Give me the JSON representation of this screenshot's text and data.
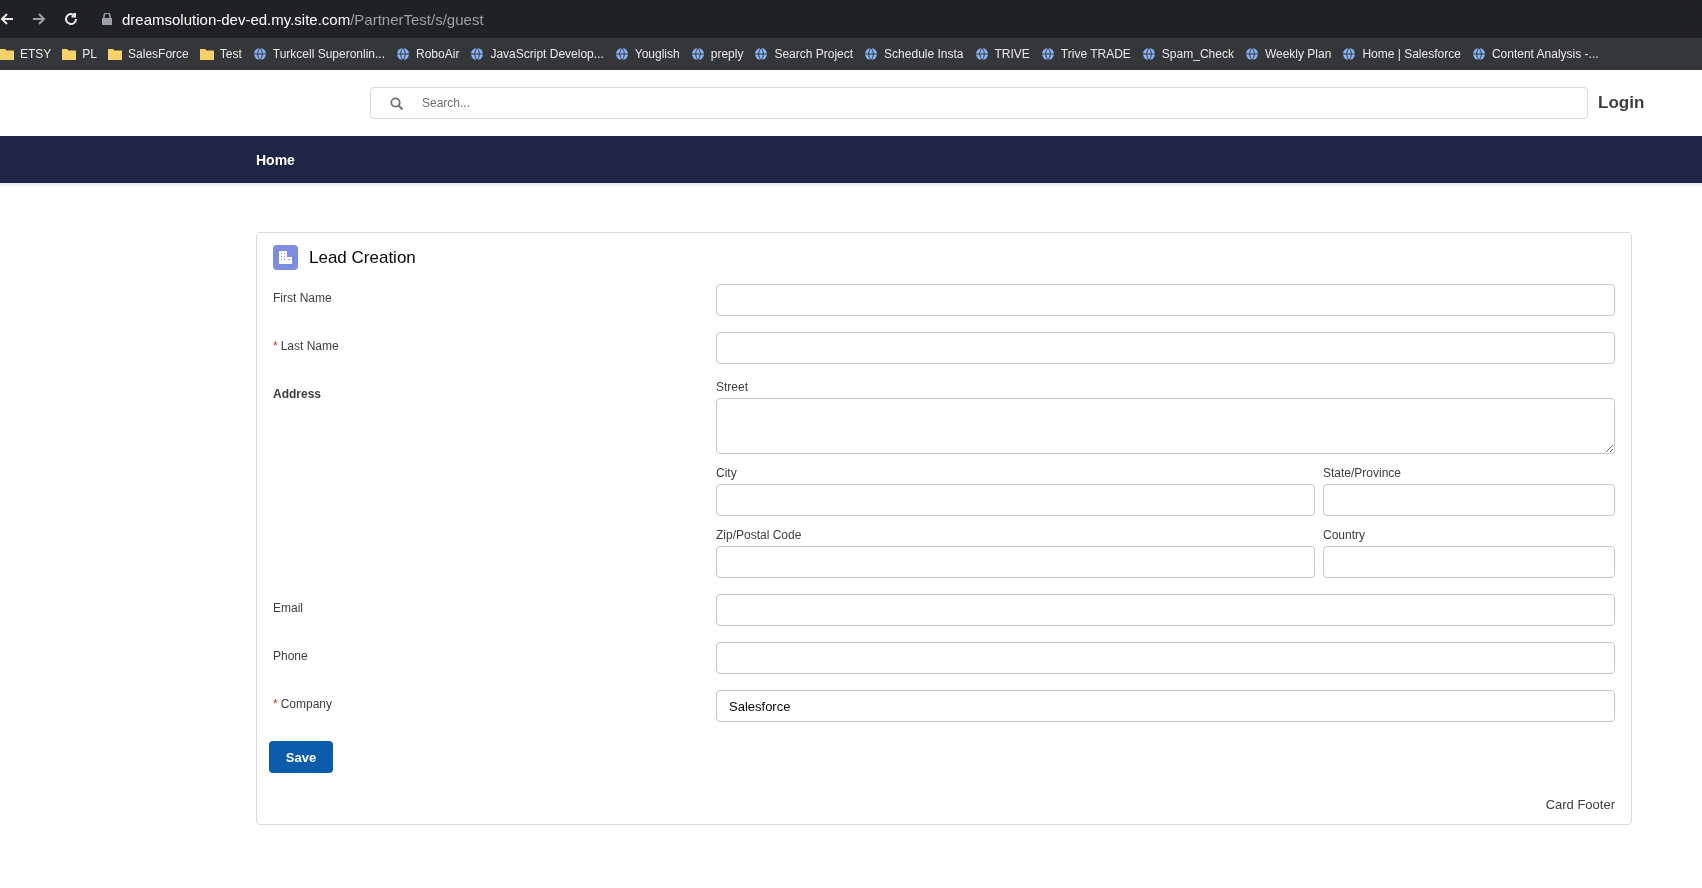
{
  "browser": {
    "url_host": "dreamsolution-dev-ed.my.site.com",
    "url_path": "/PartnerTest/s/guest",
    "bookmarks": [
      {
        "label": "ETSY",
        "kind": "folder"
      },
      {
        "label": "PL",
        "kind": "folder"
      },
      {
        "label": "SalesForce",
        "kind": "folder"
      },
      {
        "label": "Test",
        "kind": "folder"
      },
      {
        "label": "Turkcell Superonlin...",
        "kind": "site"
      },
      {
        "label": "RoboAir",
        "kind": "site"
      },
      {
        "label": "JavaScript Develop...",
        "kind": "site"
      },
      {
        "label": "Youglish",
        "kind": "site"
      },
      {
        "label": "preply",
        "kind": "site"
      },
      {
        "label": "Search Project",
        "kind": "site"
      },
      {
        "label": "Schedule Insta",
        "kind": "site"
      },
      {
        "label": "TRIVE",
        "kind": "site"
      },
      {
        "label": "Trive TRADE",
        "kind": "site"
      },
      {
        "label": "Spam_Check",
        "kind": "site"
      },
      {
        "label": "Weekly Plan",
        "kind": "site"
      },
      {
        "label": "Home | Salesforce",
        "kind": "site"
      },
      {
        "label": "Content Analysis -...",
        "kind": "site"
      }
    ]
  },
  "header": {
    "search": {
      "placeholder": "Search..."
    },
    "login": "Login"
  },
  "nav": {
    "items": [
      {
        "label": "Home"
      }
    ]
  },
  "card": {
    "title": "Lead Creation",
    "fields": [
      {
        "kind": "text",
        "label": "First Name"
      },
      {
        "kind": "text",
        "label": "Last Name",
        "required_mark": "*"
      },
      {
        "kind": "address",
        "label": "Address",
        "parts": [
          {
            "kind": "textarea",
            "label": "Street"
          },
          {
            "kind": "wide",
            "label": "City"
          },
          {
            "kind": "narrow",
            "label": "State/Province"
          },
          {
            "kind": "wide",
            "label": "Zip/Postal Code"
          },
          {
            "kind": "narrow",
            "label": "Country"
          }
        ]
      },
      {
        "kind": "text",
        "label": "Email"
      },
      {
        "kind": "text",
        "label": "Phone"
      },
      {
        "kind": "text",
        "label": "Company",
        "required_mark": "*",
        "value": "Salesforce"
      }
    ],
    "save": "Save",
    "footer": "Card Footer"
  }
}
